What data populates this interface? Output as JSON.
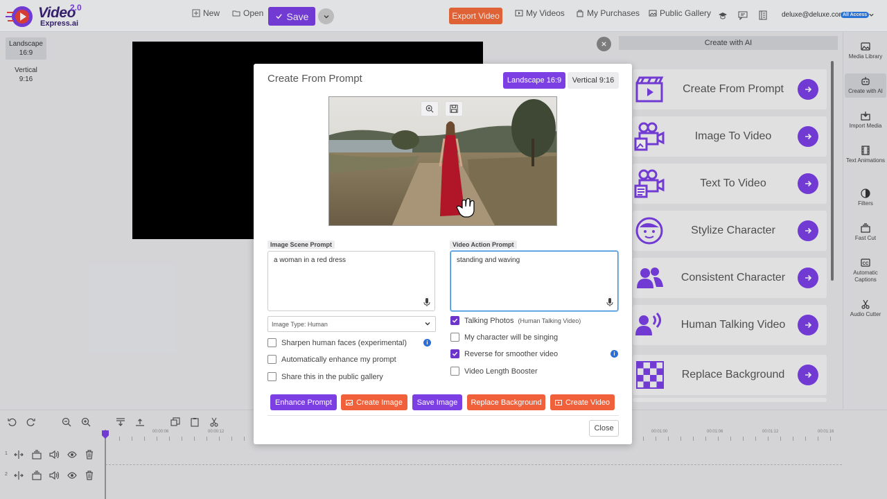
{
  "header": {
    "logo_line1": "Video",
    "logo_line2": "Express.ai",
    "logo_version": "2.0",
    "new_label": "New",
    "open_label": "Open",
    "save_label": "Save",
    "export_label": "Export Video",
    "my_videos_label": "My Videos",
    "my_purchases_label": "My Purchases",
    "public_gallery_label": "Public Gallery",
    "user_email": "deluxe@deluxe.com",
    "access_badge": "All Access"
  },
  "aspect_panel": {
    "landscape": "Landscape\n16:9",
    "landscape_line1": "Landscape",
    "landscape_line2": "16:9",
    "vertical_line1": "Vertical",
    "vertical_line2": "9:16"
  },
  "ai_panel": {
    "header": "Create with AI",
    "cards": [
      {
        "label": "Create From Prompt",
        "icon": "clapperboard-icon"
      },
      {
        "label": "Image To Video",
        "icon": "camera-image-icon"
      },
      {
        "label": "Text To Video",
        "icon": "camera-text-icon"
      },
      {
        "label": "Stylize Character",
        "icon": "face-icon"
      },
      {
        "label": "Consistent Character",
        "icon": "users-icon"
      },
      {
        "label": "Human Talking Video",
        "icon": "speaking-person-icon"
      },
      {
        "label": "Replace Background",
        "icon": "checkerboard-icon"
      }
    ]
  },
  "side_tools": [
    {
      "label": "Media Library",
      "icon": "image-icon"
    },
    {
      "label": "Create with AI",
      "icon": "robot-icon"
    },
    {
      "label": "Import Media",
      "icon": "download-icon"
    },
    {
      "label": "Text Animations",
      "icon": "film-icon"
    },
    {
      "label": "Filters",
      "icon": "filter-icon"
    },
    {
      "label": "Fast Cut",
      "icon": "stack-icon"
    },
    {
      "label": "Automatic Captions",
      "icon": "cc-icon"
    },
    {
      "label": "Audio Cutter",
      "icon": "scissors-icon"
    }
  ],
  "timeline": {
    "time_labels": [
      "00:00:06",
      "00:00:12",
      "00:01:00",
      "00:01:06",
      "00:01:12",
      "00:01:16"
    ],
    "rows": [
      "1",
      "2"
    ]
  },
  "modal": {
    "title": "Create From Prompt",
    "landscape_option": "Landscape 16:9",
    "vertical_option": "Vertical 9:16",
    "image_scene_label": "Image Scene Prompt",
    "image_scene_value": "a woman in a red dress",
    "video_action_label": "Video Action Prompt",
    "video_action_value": "standing and waving",
    "image_type": "Image Type: Human",
    "left_options": [
      {
        "label": "Sharpen human faces (experimental)",
        "checked": false,
        "info": true
      },
      {
        "label": "Automatically enhance my prompt",
        "checked": false
      },
      {
        "label": "Share this in the public gallery",
        "checked": false
      }
    ],
    "right_options": [
      {
        "label": "Talking Photos",
        "sub": "(Human Talking Video)",
        "checked": true
      },
      {
        "label": "My character will be singing",
        "checked": false
      },
      {
        "label": "Reverse for smoother video",
        "checked": true,
        "info": true
      },
      {
        "label": "Video Length Booster",
        "checked": false
      }
    ],
    "buttons": {
      "enhance": "Enhance Prompt",
      "create_image": "Create Image",
      "save_image": "Save Image",
      "replace_bg": "Replace Background",
      "create_video": "Create Video",
      "close": "Close"
    },
    "accent_purple": "#7b3fe4",
    "accent_orange": "#f0603a"
  }
}
